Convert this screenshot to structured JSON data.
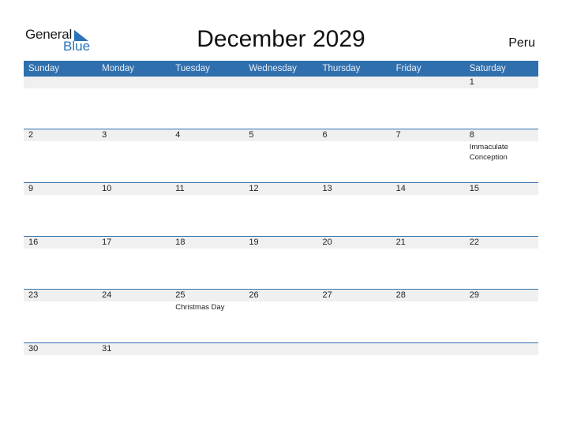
{
  "logo": {
    "line1": "General",
    "line2": "Blue"
  },
  "title": "December 2029",
  "country": "Peru",
  "colors": {
    "header_bg": "#2f6fae",
    "day_bar": "#f0f0f0",
    "accent": "#2a73b8"
  },
  "weekdays": [
    "Sunday",
    "Monday",
    "Tuesday",
    "Wednesday",
    "Thursday",
    "Friday",
    "Saturday"
  ],
  "weeks": [
    [
      {
        "d": ""
      },
      {
        "d": ""
      },
      {
        "d": ""
      },
      {
        "d": ""
      },
      {
        "d": ""
      },
      {
        "d": ""
      },
      {
        "d": "1"
      }
    ],
    [
      {
        "d": "2"
      },
      {
        "d": "3"
      },
      {
        "d": "4"
      },
      {
        "d": "5"
      },
      {
        "d": "6"
      },
      {
        "d": "7"
      },
      {
        "d": "8",
        "ev": "Immaculate Conception"
      }
    ],
    [
      {
        "d": "9"
      },
      {
        "d": "10"
      },
      {
        "d": "11"
      },
      {
        "d": "12"
      },
      {
        "d": "13"
      },
      {
        "d": "14"
      },
      {
        "d": "15"
      }
    ],
    [
      {
        "d": "16"
      },
      {
        "d": "17"
      },
      {
        "d": "18"
      },
      {
        "d": "19"
      },
      {
        "d": "20"
      },
      {
        "d": "21"
      },
      {
        "d": "22"
      }
    ],
    [
      {
        "d": "23"
      },
      {
        "d": "24"
      },
      {
        "d": "25",
        "ev": "Christmas Day"
      },
      {
        "d": "26"
      },
      {
        "d": "27"
      },
      {
        "d": "28"
      },
      {
        "d": "29"
      }
    ],
    [
      {
        "d": "30"
      },
      {
        "d": "31"
      },
      {
        "d": ""
      },
      {
        "d": ""
      },
      {
        "d": ""
      },
      {
        "d": ""
      },
      {
        "d": ""
      }
    ]
  ]
}
